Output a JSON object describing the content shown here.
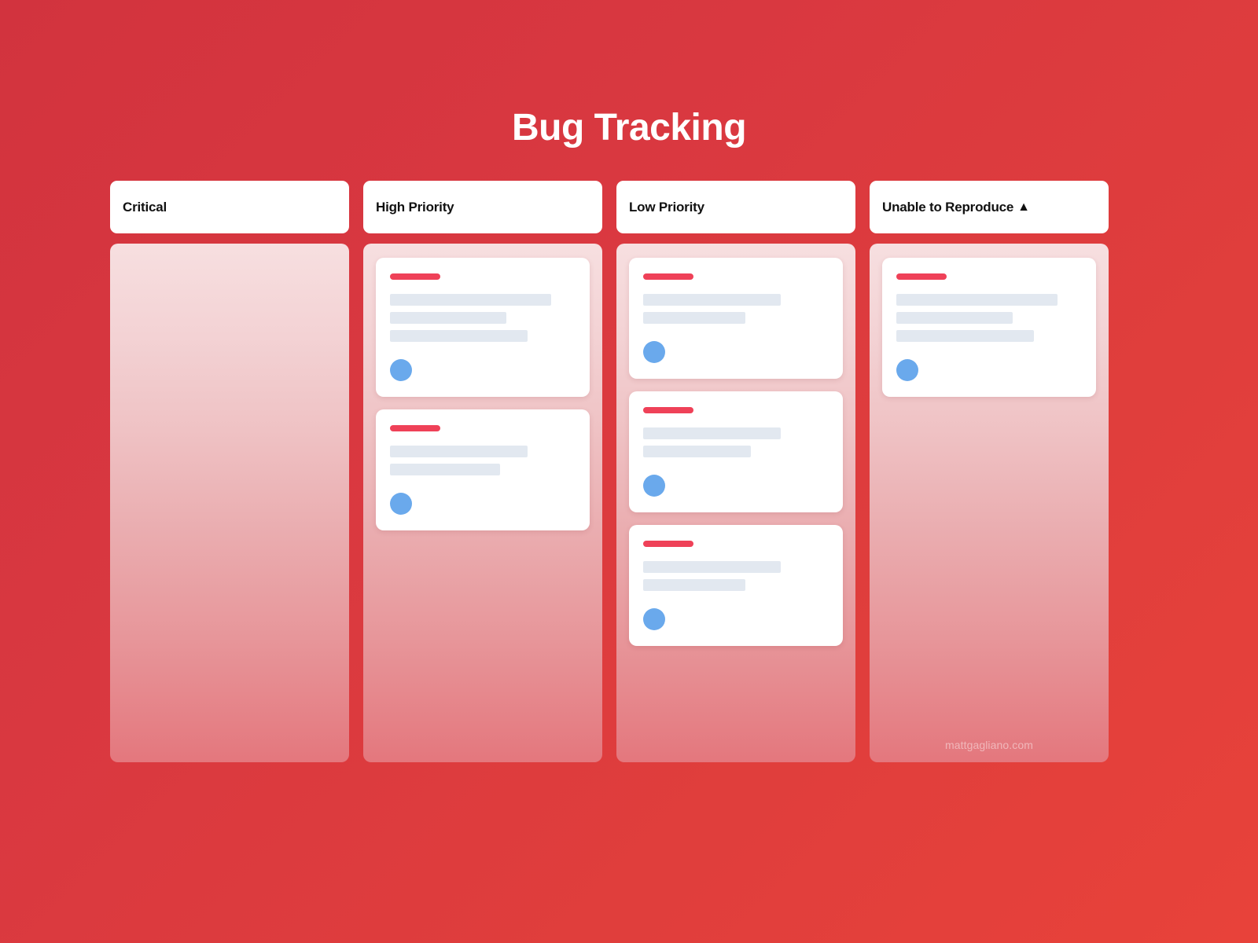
{
  "page": {
    "title": "Bug Tracking",
    "background_start": "#d2333e",
    "background_end": "#e8423a",
    "watermark": "mattgagliano.com"
  },
  "theme": {
    "card_tag_color": "#ef4158",
    "placeholder_line_color": "#e2e8f0",
    "avatar_color": "#6aa9ec",
    "column_body_top": "#f7dfe0",
    "column_body_bottom": "#e4777d",
    "header_background": "#ffffff",
    "header_text_color": "#111111"
  },
  "board": {
    "columns": [
      {
        "title": "Critical",
        "icon": "",
        "card_count": 0,
        "cards": []
      },
      {
        "title": "High Priority",
        "icon": "",
        "card_count": 2,
        "cards": [
          {
            "tag_width": 64,
            "line_widths": [
              205,
              148,
              175
            ],
            "avatar": "user-avatar"
          },
          {
            "tag_width": 64,
            "line_widths": [
              175,
              140
            ],
            "avatar": "user-avatar"
          }
        ]
      },
      {
        "title": "Low Priority",
        "icon": "",
        "card_count": 3,
        "cards": [
          {
            "tag_width": 64,
            "line_widths": [
              175,
              130
            ],
            "avatar": "user-avatar"
          },
          {
            "tag_width": 64,
            "line_widths": [
              175,
              137
            ],
            "avatar": "user-avatar"
          },
          {
            "tag_width": 64,
            "line_widths": [
              175,
              130
            ],
            "avatar": "user-avatar"
          }
        ]
      },
      {
        "title": "Unable to Reproduce",
        "icon": "▲",
        "card_count": 1,
        "cards": [
          {
            "tag_width": 64,
            "line_widths": [
              205,
              148,
              175
            ],
            "avatar": "user-avatar"
          }
        ]
      }
    ]
  }
}
